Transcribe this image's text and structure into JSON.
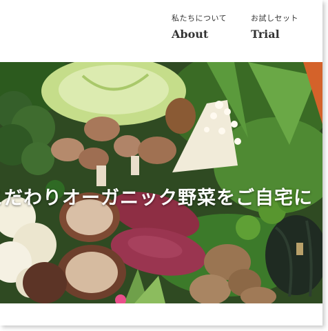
{
  "nav": {
    "items": [
      {
        "jp": "私たちについて",
        "en": "About"
      },
      {
        "jp": "お試しセット",
        "en": "Trial"
      }
    ]
  },
  "hero": {
    "tagline": "こだわりオーガニック野菜をご自宅に",
    "image_subject": "organic-vegetables-assortment"
  },
  "colors": {
    "text": "#333333",
    "tagline": "#ffffff",
    "background": "#ffffff"
  }
}
